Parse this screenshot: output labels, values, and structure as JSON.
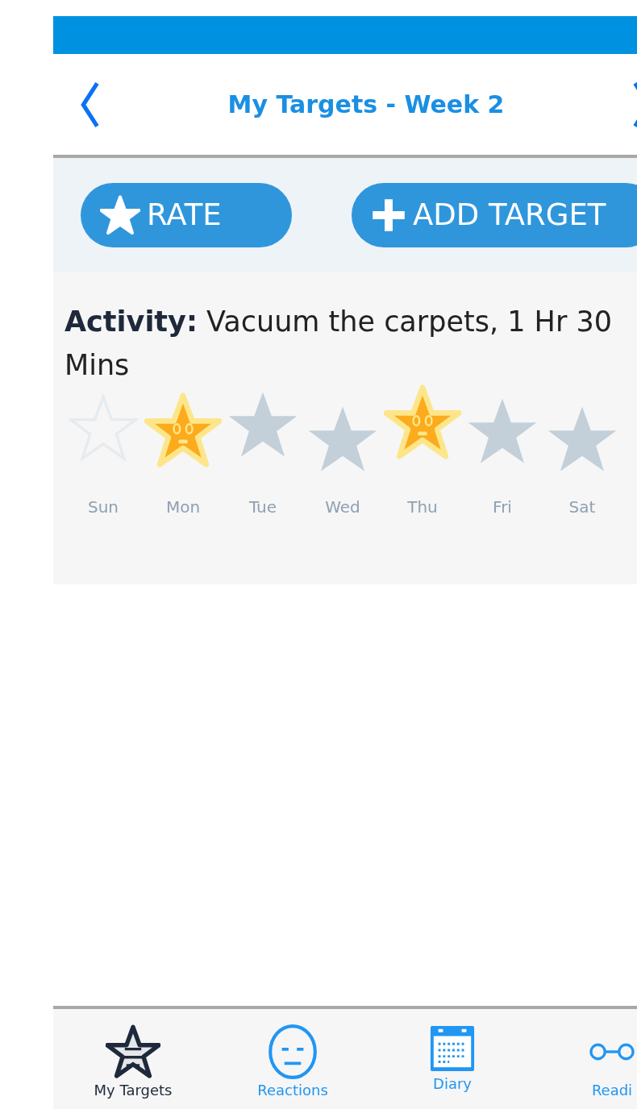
{
  "header": {
    "title": "My Targets - Week 2"
  },
  "actions": [
    {
      "kind": "rate",
      "label": "RATE"
    },
    {
      "kind": "add",
      "label": "ADD TARGET"
    }
  ],
  "activity": {
    "label": "Activity:",
    "text": "Vacuum the carpets, 1 Hr 30 Mins"
  },
  "days": [
    {
      "label": "Sun",
      "kind": "empty"
    },
    {
      "label": "Mon",
      "kind": "happy"
    },
    {
      "label": "Tue",
      "kind": "grey"
    },
    {
      "label": "Wed",
      "kind": "grey"
    },
    {
      "label": "Thu",
      "kind": "happy"
    },
    {
      "label": "Fri",
      "kind": "grey"
    },
    {
      "label": "Sat",
      "kind": "grey"
    }
  ],
  "tabs": [
    {
      "label": "My Targets",
      "kind": "star",
      "selected": true
    },
    {
      "label": "Reactions",
      "kind": "face",
      "selected": false
    },
    {
      "label": "Diary",
      "kind": "calendar",
      "selected": false
    },
    {
      "label": "Readi",
      "kind": "glasses",
      "selected": false
    }
  ]
}
